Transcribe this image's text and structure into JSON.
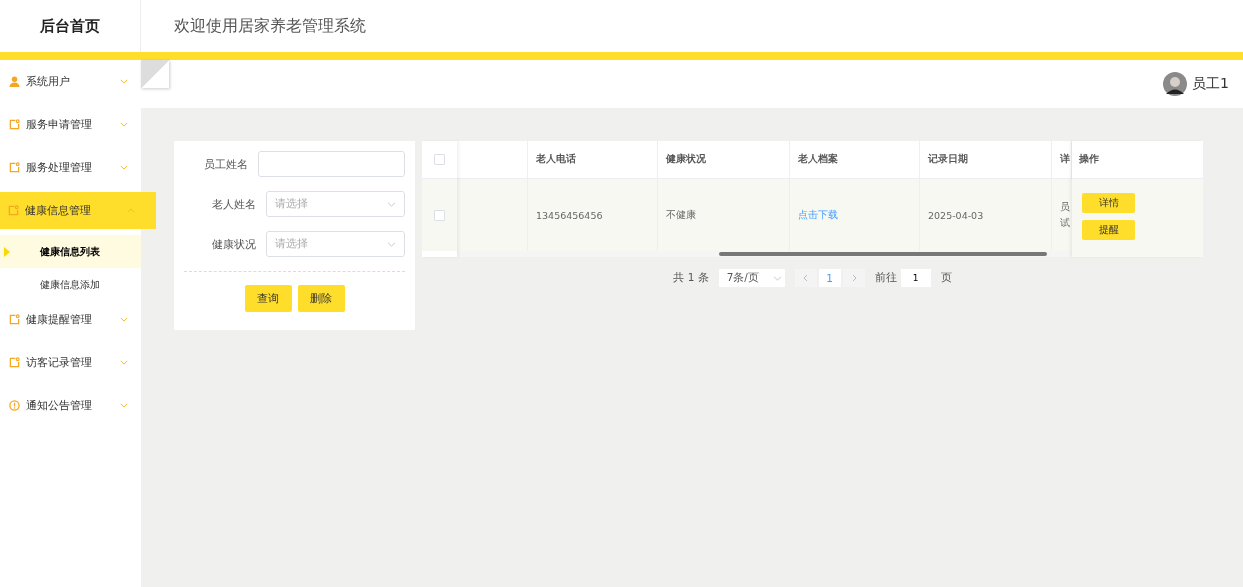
{
  "brand": "后台首页",
  "header_title": "欢迎使用居家养老管理系统",
  "user": {
    "name": "员工1"
  },
  "sidebar": {
    "items": [
      {
        "label": "系统用户",
        "expanded": false,
        "selected": false
      },
      {
        "label": "服务申请管理",
        "expanded": false,
        "selected": false
      },
      {
        "label": "服务处理管理",
        "expanded": false,
        "selected": false
      },
      {
        "label": "健康信息管理",
        "expanded": true,
        "selected": true,
        "children": [
          {
            "label": "健康信息列表",
            "selected": true
          },
          {
            "label": "健康信息添加",
            "selected": false
          }
        ]
      },
      {
        "label": "健康提醒管理",
        "expanded": false,
        "selected": false
      },
      {
        "label": "访客记录管理",
        "expanded": false,
        "selected": false
      },
      {
        "label": "通知公告管理",
        "expanded": false,
        "selected": false
      }
    ]
  },
  "search_form": {
    "fields": [
      {
        "label": "员工姓名",
        "kind": "input"
      },
      {
        "label": "老人姓名",
        "kind": "select",
        "placeholder": "请选择"
      },
      {
        "label": "健康状况",
        "kind": "select",
        "placeholder": "请选择"
      }
    ],
    "buttons": [
      "查询",
      "删除"
    ]
  },
  "table": {
    "columns": [
      "",
      "老人电话",
      "健康状况",
      "老人档案",
      "记录日期",
      "详"
    ],
    "action_column": "操作",
    "rows": [
      {
        "checked": false,
        "cells": [
          "",
          "13456456456",
          "不健康",
          "点击下载",
          "2025-04-03"
        ],
        "column_6": [
          "员",
          "试"
        ],
        "actions": [
          "详情",
          "提醒"
        ]
      }
    ],
    "header_checked": false
  },
  "pagination": {
    "total": "共 1 条",
    "page_size": "7条/页",
    "pages": [
      {
        "label": "1",
        "selected": true
      }
    ],
    "goto_label": "前往",
    "goto_value": "1",
    "page_suffix": "页"
  }
}
